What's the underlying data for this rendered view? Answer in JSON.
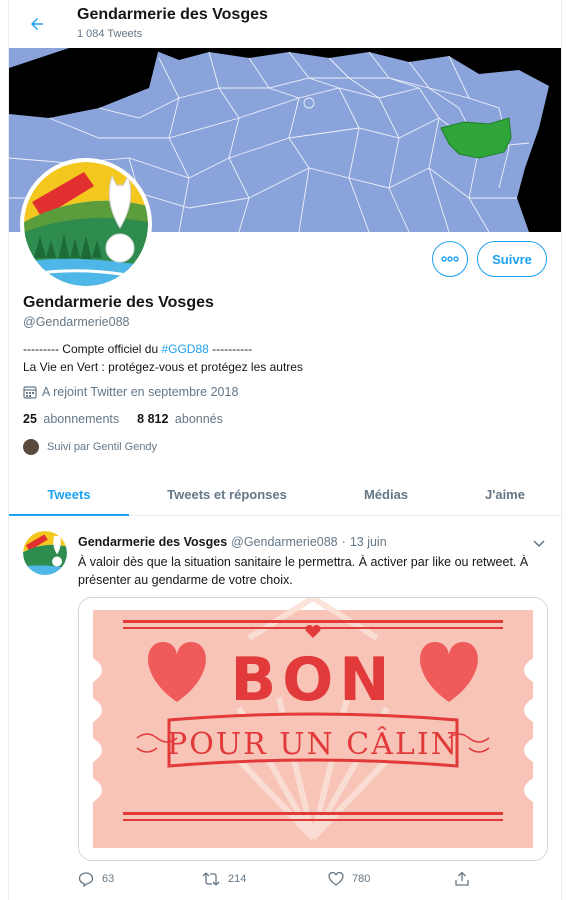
{
  "header": {
    "title": "Gendarmerie des Vosges",
    "tweet_count": "1 084 Tweets"
  },
  "profile": {
    "name": "Gendarmerie des Vosges",
    "handle": "@Gendarmerie088",
    "bio_line1_before": "--------- Compte officiel du ",
    "bio_line1_tag": "#GGD88",
    "bio_line1_after": " ----------",
    "bio_line2": "La Vie en Vert : protégez-vous et protégez les autres",
    "joined": "A rejoint Twitter en septembre 2018",
    "following_count": "25",
    "following_label": "abonnements",
    "followers_count": "8 812",
    "followers_label": "abonnés",
    "followed_by": "Suivi par Gentil Gendy",
    "follow_label": "Suivre"
  },
  "tabs": [
    {
      "label": "Tweets",
      "active": true
    },
    {
      "label": "Tweets et réponses",
      "active": false
    },
    {
      "label": "Médias",
      "active": false
    },
    {
      "label": "J'aime",
      "active": false
    }
  ],
  "tweet": {
    "author": "Gendarmerie des Vosges",
    "handle": "@Gendarmerie088",
    "separator": "·",
    "date": "13 juin",
    "text": "À valoir dès que la situation sanitaire le permettra. À activer par like ou retweet. À présenter au gendarme de votre choix.",
    "image_text_main": "BON",
    "image_text_sub": "POUR UN CÂLIN",
    "replies": "63",
    "retweets": "214",
    "likes": "780"
  },
  "colors": {
    "accent": "#1da1f2",
    "map_fill": "#89a2d9",
    "map_highlight": "#2fa53a",
    "coupon_bg": "#f7c4b7",
    "coupon_red": "#e23a3a"
  },
  "icons": [
    "back-arrow-icon",
    "more-icon",
    "calendar-icon",
    "caret-down-icon",
    "reply-icon",
    "retweet-icon",
    "like-icon",
    "share-icon"
  ]
}
